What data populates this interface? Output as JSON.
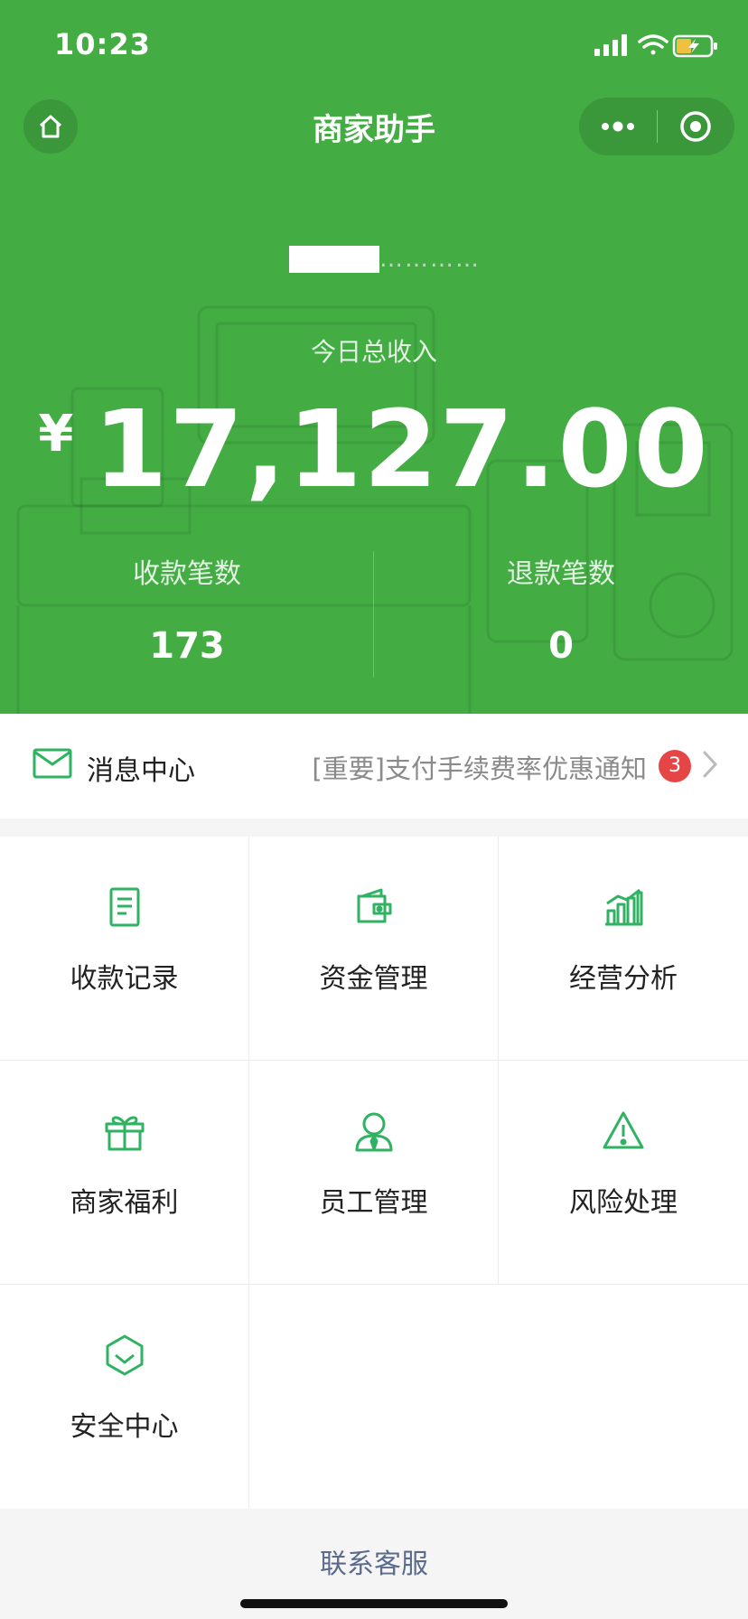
{
  "status_bar": {
    "time": "10:23"
  },
  "nav": {
    "title": "商家助手"
  },
  "store": {
    "name_visible": "…………"
  },
  "income": {
    "label": "今日总收入",
    "currency": "¥",
    "amount": "17,127.00"
  },
  "stats": {
    "payments_label": "收款笔数",
    "payments_value": "173",
    "refunds_label": "退款笔数",
    "refunds_value": "0"
  },
  "messages": {
    "title": "消息中心",
    "latest": "[重要]支付手续费率优惠通知",
    "unread_count": "3"
  },
  "menu": [
    {
      "label": "收款记录",
      "icon": "receipt-icon"
    },
    {
      "label": "资金管理",
      "icon": "wallet-icon"
    },
    {
      "label": "经营分析",
      "icon": "bar-chart-icon"
    },
    {
      "label": "商家福利",
      "icon": "gift-icon"
    },
    {
      "label": "员工管理",
      "icon": "employee-icon"
    },
    {
      "label": "风险处理",
      "icon": "warning-icon"
    },
    {
      "label": "安全中心",
      "icon": "shield-icon"
    }
  ],
  "footer": {
    "contact_label": "联系客服"
  },
  "colors": {
    "brand_green": "#43ac43",
    "icon_green": "#2fb261",
    "badge_red": "#e54545",
    "link_blue": "#5a6b8c"
  }
}
